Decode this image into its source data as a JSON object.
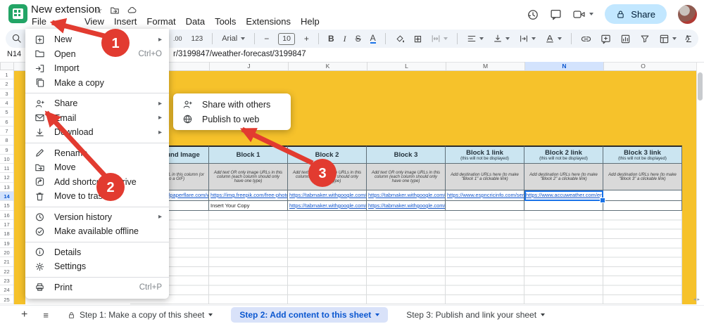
{
  "app": {
    "doc_title": "New extension",
    "menu_items": [
      "File",
      "View",
      "Insert",
      "Format",
      "Data",
      "Tools",
      "Extensions",
      "Help"
    ],
    "share_label": "Share"
  },
  "toolbar": {
    "decimal_label": ".00",
    "number_label": "123",
    "font_name": "Arial",
    "font_size": "10",
    "minus": "−",
    "plus": "+",
    "bold": "B",
    "italic": "I",
    "strike": "S",
    "text_color": "A",
    "borders": "⊞",
    "sigma": "Σ",
    "collapse": "∧"
  },
  "formula_bar": {
    "cell_ref": "N14",
    "content": "r/3199847/weather-forecast/3199847"
  },
  "grid": {
    "columns": [
      "J",
      "K",
      "L",
      "M",
      "N",
      "O"
    ],
    "selected_column": "N",
    "row_count": 25,
    "selected_row": 14
  },
  "file_menu": {
    "items": [
      {
        "label": "New"
      },
      {
        "label": "Open",
        "shortcut": "Ctrl+O"
      },
      {
        "label": "Import"
      },
      {
        "label": "Make a copy"
      },
      {
        "label": "Share"
      },
      {
        "label": "Email"
      },
      {
        "label": "Download"
      },
      {
        "label": "Rename"
      },
      {
        "label": "Move"
      },
      {
        "label": "Add shortcut to Drive"
      },
      {
        "label": "Move to trash"
      },
      {
        "label": "Version history"
      },
      {
        "label": "Make available offline"
      },
      {
        "label": "Details"
      },
      {
        "label": "Settings"
      },
      {
        "label": "Print",
        "shortcut": "Ctrl+P"
      }
    ]
  },
  "share_submenu": {
    "items": [
      {
        "label": "Share with others"
      },
      {
        "label": "Publish to web"
      }
    ]
  },
  "sheet_table": {
    "columns": [
      {
        "header": "Background Image",
        "sub": "",
        "note": "Add an image URL in this column (or a URL to a GIF)"
      },
      {
        "header": "Block 1",
        "sub": "",
        "note": "Add text OR only image URLs in this column (each column should only have one type)"
      },
      {
        "header": "Block 2",
        "sub": "",
        "note": "Add text OR only image URLs in this column (each column should only have one type)"
      },
      {
        "header": "Block 3",
        "sub": "",
        "note": "Add text OR only image URLs in this column (each column should only have one type)"
      },
      {
        "header": "Block 1 link",
        "sub": "(this will not be displayed)",
        "note": "Add destination URLs here (to make \"Block 1\" a clickable link)"
      },
      {
        "header": "Block 2 link",
        "sub": "(this will not be displayed)",
        "note": "Add destination URLs here (to make \"Block 2\" a clickable link)"
      },
      {
        "header": "Block 3 link",
        "sub": "(this will not be displayed)",
        "note": "Add destination URLs here (to make \"Block 3\" a clickable link)"
      }
    ],
    "row14": [
      "https://www.wallpaperflare.com/wallpaper",
      "https://img.freepik.com/free-photo/s",
      "https://tabmaker.withgoogle.com/as",
      "https://tabmaker.withgoogle.com/as",
      "https://www.espncricinfo.com/series/ic",
      "https://www.accuweather.com/en/in/bl",
      ""
    ],
    "row15": [
      "",
      "Insert Your Copy",
      "https://tabmaker.withgoogle.com/as",
      "https://tabmaker.withgoogle.com/as",
      "",
      "",
      ""
    ]
  },
  "sheet_tabs": {
    "tab1": "Step 1: Make a copy of this sheet",
    "tab2": "Step 2: Add content to this sheet",
    "tab3": "Step 3: Publish and link your sheet"
  },
  "annotations": {
    "step1": "1",
    "step2": "2",
    "step3": "3"
  },
  "colors": {
    "accent_yellow": "#F6C22B",
    "table_header_blue": "#CBE5F1",
    "note_gray": "#D9D9D9",
    "annotation_red": "#E23B30",
    "link_blue": "#1155CC",
    "selection_blue": "#1A73E8"
  }
}
